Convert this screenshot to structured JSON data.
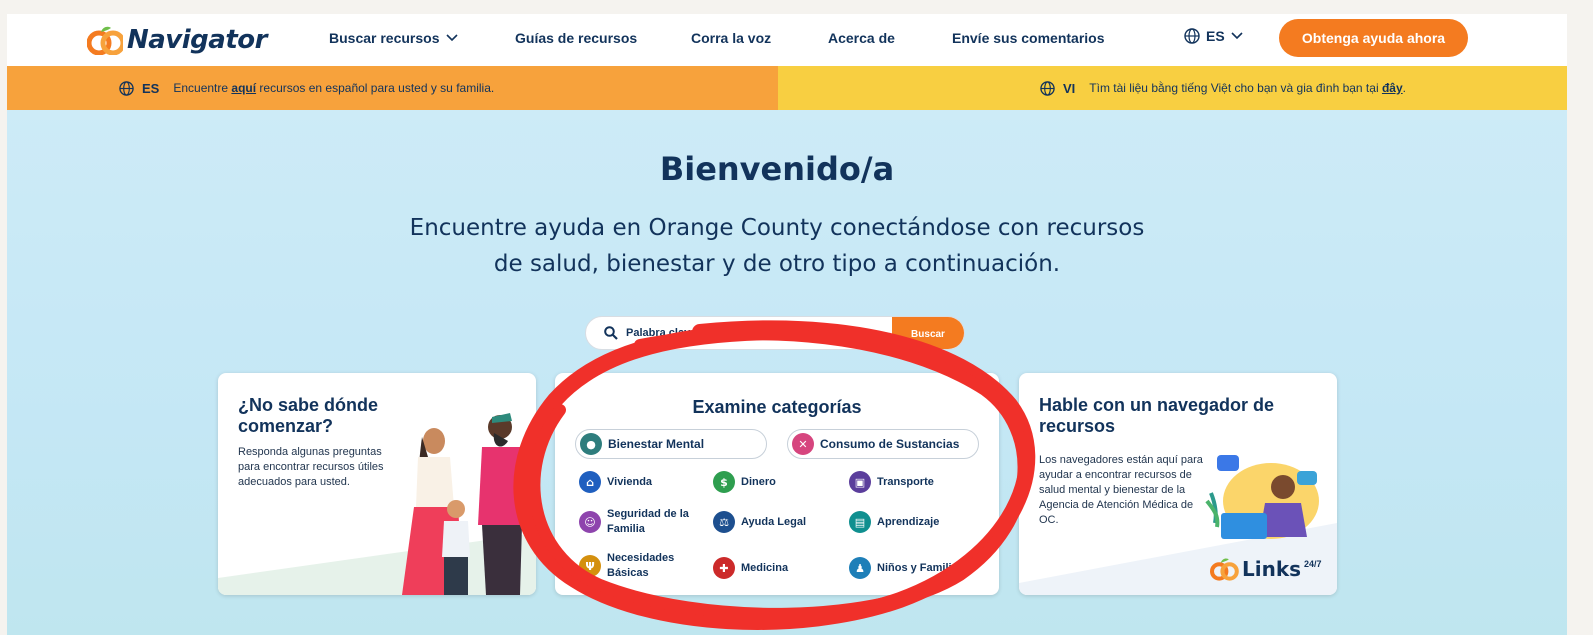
{
  "header": {
    "logo_text": "Navigator",
    "nav": [
      "Buscar recursos",
      "Guías de recursos",
      "Corra la voz",
      "Acerca de",
      "Envíe sus comentarios"
    ],
    "lang_code": "ES",
    "help_button": "Obtenga ayuda ahora"
  },
  "banner_es": {
    "code": "ES",
    "text_before": "Encuentre",
    "link": "aquí",
    "text_after": "recursos en español para usted y su familia."
  },
  "banner_vi": {
    "code": "VI",
    "text_before": "Tìm tài liệu bằng tiếng Việt cho bạn và gia đình bạn tại",
    "link": "đây",
    "text_after": "."
  },
  "hero": {
    "title": "Bienvenido/a",
    "subtitle_line1": "Encuentre ayuda en Orange County conectándose con recursos",
    "subtitle_line2": "de salud, bienestar y de otro tipo a continuación.",
    "search_placeholder": "Palabra clave",
    "search_button": "Buscar"
  },
  "card_start": {
    "title_line1": "¿No sabe dónde",
    "title_line2": "comenzar?",
    "text_line1": "Responda algunas preguntas",
    "text_line2": "para encontrar recursos útiles",
    "text_line3": "adecuados para usted."
  },
  "card_categories": {
    "title": "Examine categorías",
    "pills": [
      {
        "label": "Bienestar Mental",
        "color": "#2e7d7d",
        "icon": "brain-icon"
      },
      {
        "label": "Consumo de Sustancias",
        "color": "#d6457e",
        "icon": "pill-icon"
      }
    ],
    "items": [
      {
        "label": "Vivienda",
        "color": "#1f5fbf",
        "icon": "home-icon"
      },
      {
        "label": "Dinero",
        "color": "#2e9e4f",
        "icon": "dollar-icon"
      },
      {
        "label": "Transporte",
        "color": "#5b3e9c",
        "icon": "bus-icon"
      },
      {
        "label": "Seguridad de la Familia",
        "color": "#8e44ad",
        "icon": "shield-icon"
      },
      {
        "label": "Ayuda Legal",
        "color": "#1d4f8f",
        "icon": "scales-icon"
      },
      {
        "label": "Aprendizaje",
        "color": "#0f8f8f",
        "icon": "book-icon"
      },
      {
        "label": "Necesidades Básicas",
        "color": "#d4900e",
        "icon": "utensils-icon"
      },
      {
        "label": "Medicina",
        "color": "#cc2a2a",
        "icon": "medical-cross-icon"
      },
      {
        "label": "Niños y Familias",
        "color": "#1e7fb8",
        "icon": "child-icon"
      }
    ]
  },
  "card_navigator": {
    "title_line1": "Hable con un navegador de",
    "title_line2": "recursos",
    "text_line1": "Los navegadores están aquí para",
    "text_line2": "ayudar a encontrar recursos de",
    "text_line3": "salud mental y bienestar de la",
    "text_line4": "Agencia de Atención Médica de",
    "text_line5": "OC.",
    "brand": "Links",
    "brand_sup": "24/7"
  },
  "colors": {
    "navy": "#12335b",
    "orange": "#f47b20",
    "banner_orange": "#f7a23c",
    "banner_yellow": "#f8cf41",
    "annotation_red": "#f0302a"
  }
}
